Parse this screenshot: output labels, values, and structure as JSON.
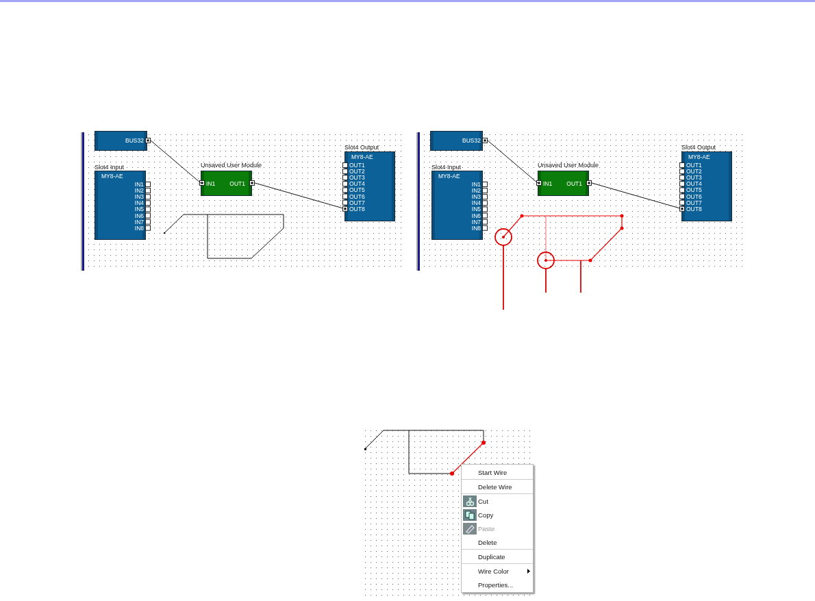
{
  "figures": [
    {
      "kind": "plain",
      "bus_port": "BUS32",
      "input": {
        "title": "Slot4 Input",
        "model": "MY8-AE",
        "ports": [
          "IN1",
          "IN2",
          "IN3",
          "IN4",
          "IN5",
          "IN6",
          "IN7",
          "IN8"
        ]
      },
      "module": {
        "title": "Unsaved User Module",
        "in_port": "IN1",
        "out_port": "OUT1"
      },
      "output": {
        "title": "Slot4 Output",
        "model": "MY8-AE",
        "ports": [
          "OUT1",
          "OUT2",
          "OUT3",
          "OUT4",
          "OUT5",
          "OUT6",
          "OUT7",
          "OUT8"
        ]
      }
    },
    {
      "kind": "annotated",
      "bus_port": "BUS32",
      "input": {
        "title": "Slot4 Input",
        "model": "MY8-AE",
        "ports": [
          "IN1",
          "IN2",
          "IN3",
          "IN4",
          "IN5",
          "IN6",
          "IN7",
          "IN8"
        ]
      },
      "module": {
        "title": "Unsaved User Module",
        "in_port": "IN1",
        "out_port": "OUT1"
      },
      "output": {
        "title": "Slot4 Output",
        "model": "MY8-AE",
        "ports": [
          "OUT1",
          "OUT2",
          "OUT3",
          "OUT4",
          "OUT5",
          "OUT6",
          "OUT7",
          "OUT8"
        ]
      }
    }
  ],
  "context_menu": {
    "items": [
      {
        "label": "Start Wire",
        "kind": "plain",
        "disabled": false,
        "submenu": false,
        "separator_after": true
      },
      {
        "label": "Delete Wire",
        "kind": "plain",
        "disabled": false,
        "submenu": false,
        "separator_after": true
      },
      {
        "label": "Cut",
        "kind": "cut",
        "disabled": false,
        "submenu": false,
        "separator_after": false
      },
      {
        "label": "Copy",
        "kind": "copy",
        "disabled": false,
        "submenu": false,
        "separator_after": false
      },
      {
        "label": "Paste",
        "kind": "paste",
        "disabled": true,
        "submenu": false,
        "separator_after": false
      },
      {
        "label": "Delete",
        "kind": "plain",
        "disabled": false,
        "submenu": false,
        "separator_after": true
      },
      {
        "label": "Duplicate",
        "kind": "plain",
        "disabled": false,
        "submenu": false,
        "separator_after": true
      },
      {
        "label": "Wire Color",
        "kind": "plain",
        "disabled": false,
        "submenu": true,
        "separator_after": false
      },
      {
        "label": "Properties...",
        "kind": "plain",
        "disabled": false,
        "submenu": false,
        "separator_after": false
      }
    ]
  }
}
